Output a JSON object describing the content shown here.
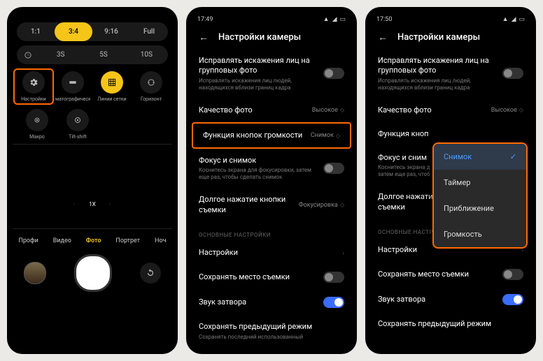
{
  "phone1": {
    "ratios": [
      "1:1",
      "3:4",
      "9:16",
      "Full"
    ],
    "ratio_active": 1,
    "timer_opts": [
      "3S",
      "5S",
      "10S"
    ],
    "tools": [
      {
        "label": "Настройки",
        "icon": "gear"
      },
      {
        "label": "матографическ",
        "icon": "wide"
      },
      {
        "label": "Линии сетки",
        "icon": "grid"
      },
      {
        "label": "Горизонт",
        "icon": "level"
      }
    ],
    "tools2": [
      {
        "label": "Макро",
        "icon": "macro"
      },
      {
        "label": "Tilt-shift",
        "icon": "tilt"
      }
    ],
    "zoom": [
      "·",
      "1X",
      "·"
    ],
    "modes": [
      "Профи",
      "Видео",
      "Фото",
      "Портрет",
      "Ноч"
    ],
    "mode_active": 2
  },
  "phone2": {
    "status_time": "17:49",
    "title": "Настройки камеры",
    "rows": {
      "distort": {
        "t": "Исправлять искажения лиц на групповых фото",
        "s": "Исправлять искажения лиц людей, находящихся вблизи границ кадра"
      },
      "quality": {
        "t": "Качество фото",
        "v": "Высокое"
      },
      "volfn": {
        "t": "Функция кнопок громкости",
        "v": "Снимок"
      },
      "focus": {
        "t": "Фокус и снимок",
        "s": "Коснитесь экрана для фокусировки, затем еще раз, чтобы сделать снимок"
      },
      "long": {
        "t": "Долгое нажатие кнопки съемки",
        "v": "Фокусировка"
      },
      "section": "ОСНОВНЫЕ НАСТРОЙКИ",
      "settings": {
        "t": "Настройки"
      },
      "saveloc": {
        "t": "Сохранять место съемки"
      },
      "shutter_snd": {
        "t": "Звук затвора"
      },
      "prevmode": {
        "t": "Сохранять предыдущий режим",
        "s": "Сохранять последний использованный"
      }
    }
  },
  "phone3": {
    "status_time": "17:50",
    "title": "Настройки камеры",
    "volfn_short": "Функция кноп",
    "focus_short": "Фокус и сним",
    "focus_sub_short": "Коснитесь экрана д\nзатем еще раз, чтоб",
    "long_short": "Долгое нажати\nсъемки",
    "popup": [
      "Снимок",
      "Таймер",
      "Приближение",
      "Громкость"
    ],
    "popup_sel": 0
  }
}
